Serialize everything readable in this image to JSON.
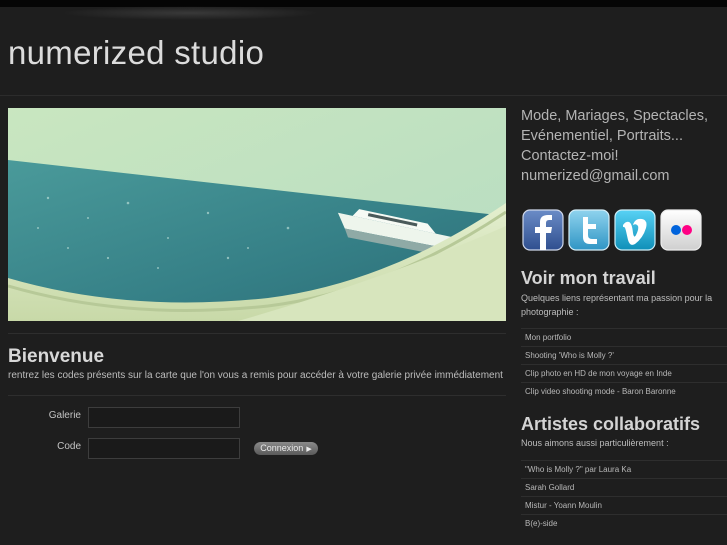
{
  "site": {
    "title": "numerized studio"
  },
  "welcome": {
    "title": "Bienvenue",
    "text": "rentrez les codes présents sur la carte que l'on vous a remis pour accéder à votre galerie privée immédiatement"
  },
  "login_form": {
    "galerie_label": "Galerie",
    "galerie_value": "",
    "code_label": "Code",
    "code_value": "",
    "submit_label": "Connexion"
  },
  "sidebar": {
    "tagline": [
      "Mode, Mariages, Spectacles,",
      "Evénementiel, Portraits...",
      "Contactez-moi!",
      "numerized@gmail.com"
    ],
    "social": [
      {
        "icon": "facebook-icon",
        "color": "#3b5998"
      },
      {
        "icon": "twitter-icon",
        "color": "#3fa9d5"
      },
      {
        "icon": "vimeo-icon",
        "color": "#1ab7ea"
      },
      {
        "icon": "flickr-icon",
        "color": "#e0e0e0"
      }
    ],
    "work": {
      "title": "Voir mon travail",
      "subtitle": "Quelques liens représentant ma passion pour la photographie :",
      "links": [
        "Mon portfolio",
        "Shooting 'Who is Molly ?'",
        "Clip photo en HD de mon voyage en Inde",
        "Clip video shooting mode - Baron Baronne"
      ]
    },
    "artists": {
      "title": "Artistes collaboratifs",
      "subtitle": "Nous aimons aussi particulièrement :",
      "links": [
        "\"Who is Molly ?\" par Laura Ka",
        "Sarah Gollard",
        "Mistur - Yoann Moulin",
        "B(e)-side"
      ]
    }
  }
}
